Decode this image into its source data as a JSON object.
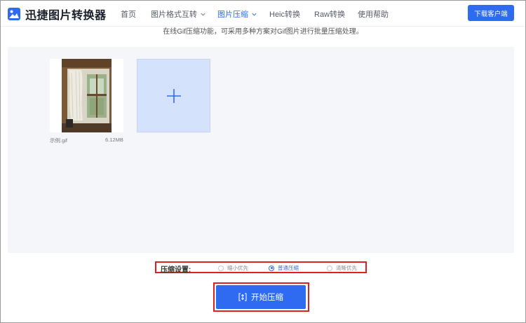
{
  "header": {
    "app_name": "迅捷图片转换器",
    "nav": [
      {
        "label": "首页",
        "active": false,
        "dropdown": false
      },
      {
        "label": "图片格式互转",
        "active": false,
        "dropdown": true
      },
      {
        "label": "图片压缩",
        "active": true,
        "dropdown": true
      },
      {
        "label": "Heic转换",
        "active": false,
        "dropdown": false
      },
      {
        "label": "Raw转换",
        "active": false,
        "dropdown": false
      },
      {
        "label": "使用帮助",
        "active": false,
        "dropdown": false
      }
    ],
    "download_label": "下载客户端"
  },
  "intro_text": "在线Gif压缩功能，可采用多种方案对Gif图片进行批量压缩处理。",
  "upload": {
    "files": [
      {
        "name": "示例.gif",
        "size": "6.12MB"
      }
    ],
    "add_icon": "plus-icon"
  },
  "settings": {
    "label": "压缩设置:",
    "options": [
      {
        "label": "缩小优先",
        "checked": false
      },
      {
        "label": "普通压缩",
        "checked": true
      },
      {
        "label": "清晰优先",
        "checked": false
      }
    ]
  },
  "start_button": {
    "label": "开始压缩",
    "icon": "compress-icon"
  },
  "colors": {
    "accent": "#2f6bf0",
    "highlight": "#e02020",
    "panel": "#f4f6f9"
  }
}
